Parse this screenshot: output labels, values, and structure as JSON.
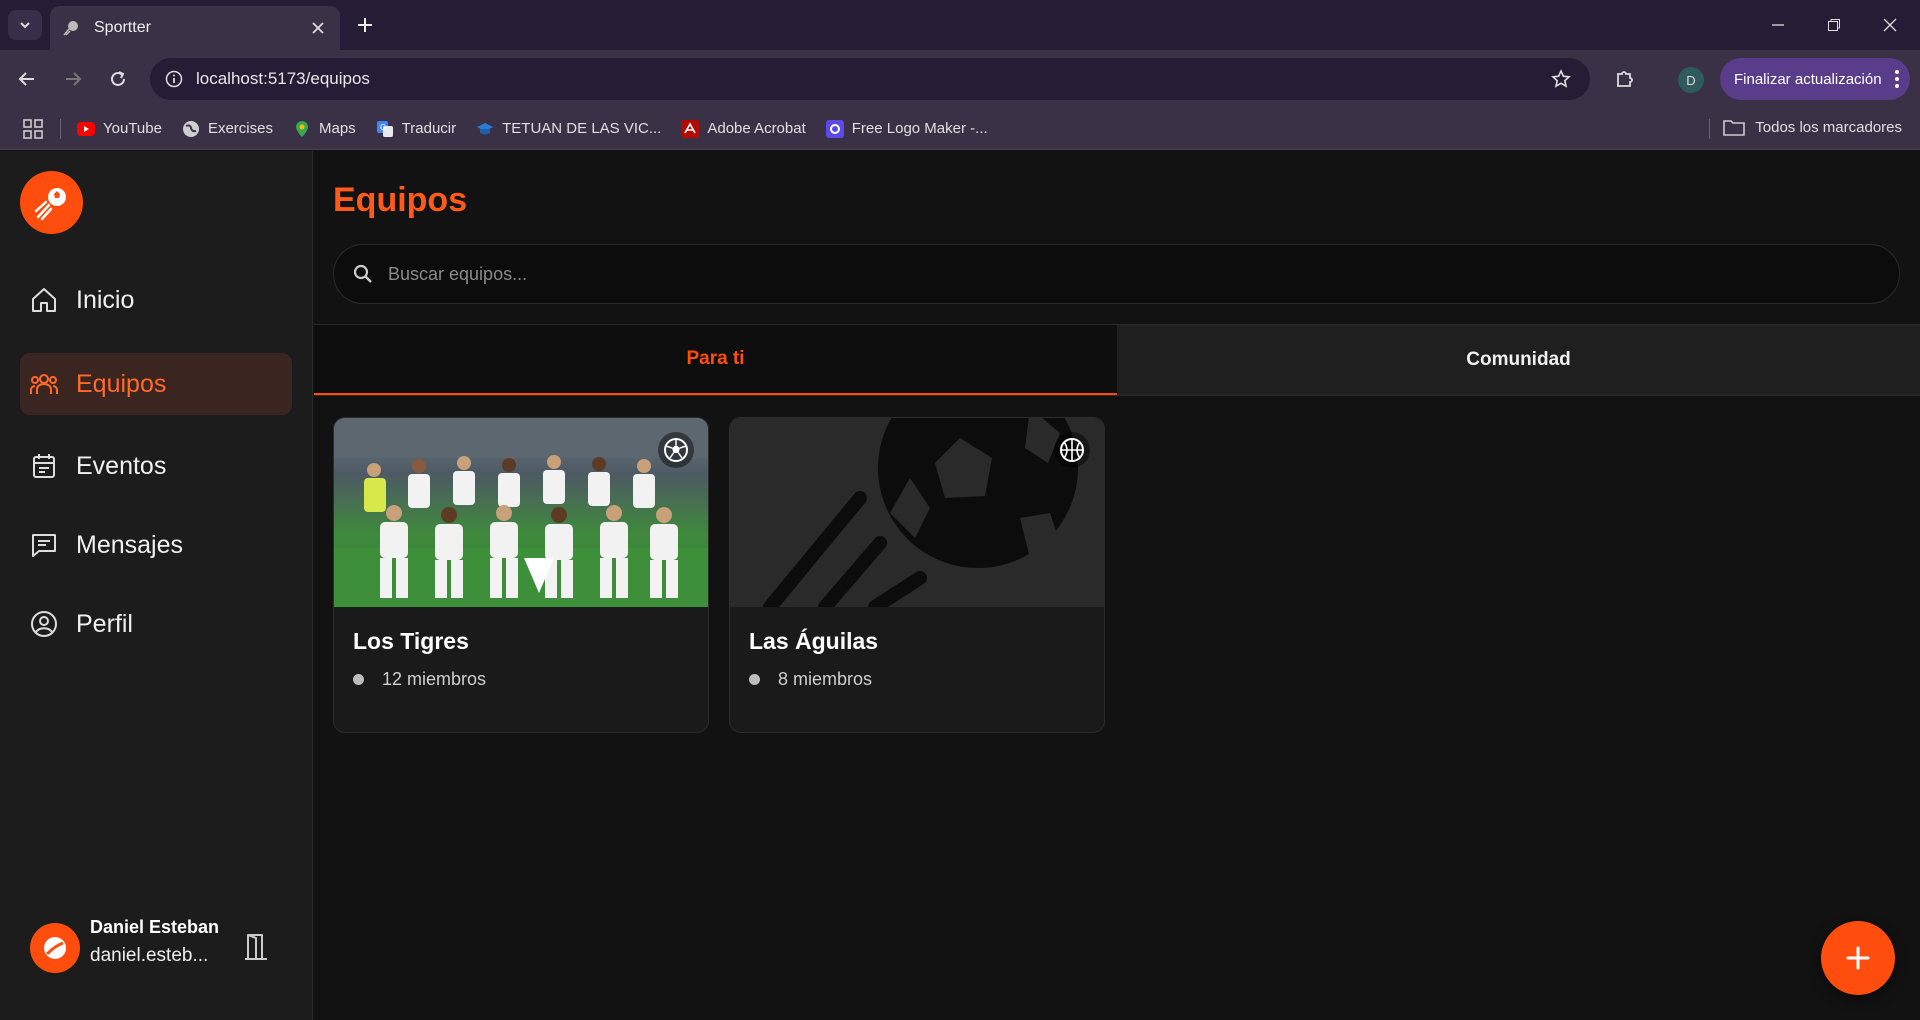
{
  "browser": {
    "tab_title": "Sportter",
    "url": "localhost:5173/equipos",
    "update_button": "Finalizar actualización",
    "profile_initial": "D",
    "bookmarks": [
      {
        "label": "YouTube",
        "icon": "youtube-icon"
      },
      {
        "label": "Exercises",
        "icon": "globe-icon"
      },
      {
        "label": "Maps",
        "icon": "maps-icon"
      },
      {
        "label": "Traducir",
        "icon": "translate-icon"
      },
      {
        "label": "TETUAN DE LAS VIC...",
        "icon": "school-icon"
      },
      {
        "label": "Adobe Acrobat",
        "icon": "acrobat-icon"
      },
      {
        "label": "Free Logo Maker -...",
        "icon": "logo-maker-icon"
      }
    ],
    "all_bookmarks": "Todos los marcadores"
  },
  "sidebar": {
    "items": [
      {
        "label": "Inicio",
        "icon": "home-icon"
      },
      {
        "label": "Equipos",
        "icon": "teams-icon",
        "active": true
      },
      {
        "label": "Eventos",
        "icon": "calendar-icon"
      },
      {
        "label": "Mensajes",
        "icon": "messages-icon"
      },
      {
        "label": "Perfil",
        "icon": "profile-icon"
      }
    ],
    "user": {
      "name": "Daniel Esteban",
      "email": "daniel.esteb..."
    }
  },
  "main": {
    "title": "Equipos",
    "search_placeholder": "Buscar equipos...",
    "tabs": [
      {
        "label": "Para ti",
        "active": true
      },
      {
        "label": "Comunidad",
        "active": false
      }
    ],
    "teams": [
      {
        "name": "Los Tigres",
        "members": "12 miembros",
        "sport": "soccer-icon"
      },
      {
        "name": "Las Águilas",
        "members": "8 miembros",
        "sport": "basketball-icon"
      }
    ]
  },
  "colors": {
    "accent": "#ff4d0d",
    "sidebar_bg": "#1c1c1c",
    "main_bg": "#121212"
  }
}
